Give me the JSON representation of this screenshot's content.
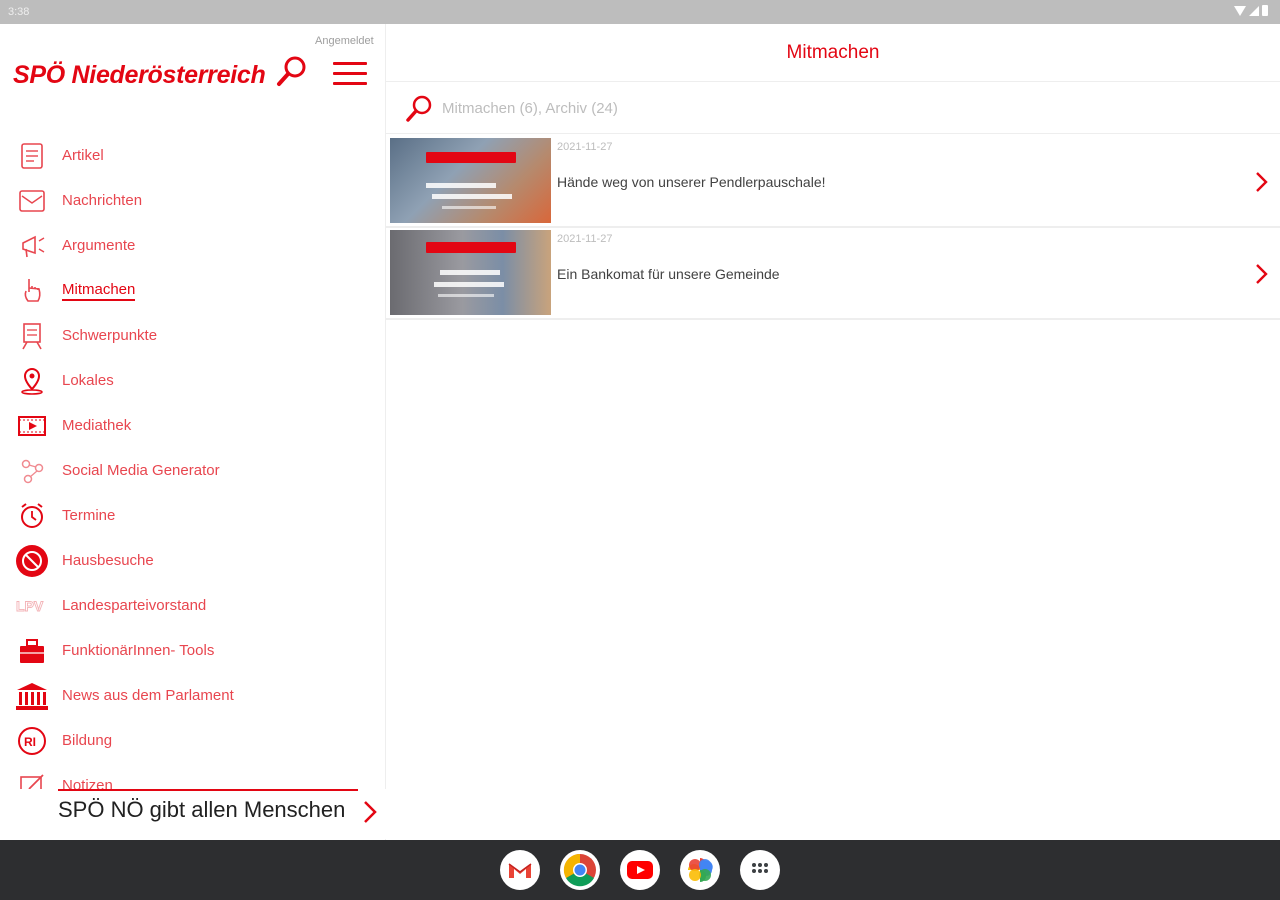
{
  "status_bar": {
    "time": "3:38"
  },
  "sidebar": {
    "signed_in": "Angemeldet",
    "brand": "SPÖ Niederösterreich",
    "items": [
      {
        "label": "Artikel",
        "icon": "article-icon"
      },
      {
        "label": "Nachrichten",
        "icon": "envelope-icon"
      },
      {
        "label": "Argumente",
        "icon": "megaphone-icon"
      },
      {
        "label": "Mitmachen",
        "icon": "hand-pointer-icon",
        "active": true
      },
      {
        "label": "Schwerpunkte",
        "icon": "easel-icon"
      },
      {
        "label": "Lokales",
        "icon": "map-pin-icon"
      },
      {
        "label": "Mediathek",
        "icon": "film-icon"
      },
      {
        "label": "Social Media Generator",
        "icon": "share-network-icon"
      },
      {
        "label": "Termine",
        "icon": "alarm-clock-icon"
      },
      {
        "label": "Hausbesuche",
        "icon": "doorbell-icon"
      },
      {
        "label": "Landesparteivorstand",
        "icon": "lpv-logo-icon"
      },
      {
        "label": "FunktionärInnen- Tools",
        "icon": "toolbox-icon"
      },
      {
        "label": "News aus dem Parlament",
        "icon": "parliament-icon"
      },
      {
        "label": "Bildung",
        "icon": "education-badge-icon"
      },
      {
        "label": "Notizen",
        "icon": "note-edit-icon"
      }
    ],
    "slogan": "SPÖ NÖ gibt allen Menschen"
  },
  "main": {
    "title": "Mitmachen",
    "search_placeholder": "Mitmachen (6), Archiv (24)",
    "rows": [
      {
        "date": "2021-11-27",
        "title": "Hände weg von unserer Pendlerpauschale!"
      },
      {
        "date": "2021-11-27",
        "title": "Ein Bankomat für unsere Gemeinde"
      }
    ]
  },
  "dock": {
    "apps": [
      "gmail-icon",
      "chrome-icon",
      "youtube-icon",
      "photos-icon",
      "app-drawer-icon"
    ]
  },
  "colors": {
    "accent": "#e30613",
    "nav_text": "#e8464f",
    "dock_bg": "#2d2e30",
    "statusbar_bg": "#bdbdbd"
  }
}
